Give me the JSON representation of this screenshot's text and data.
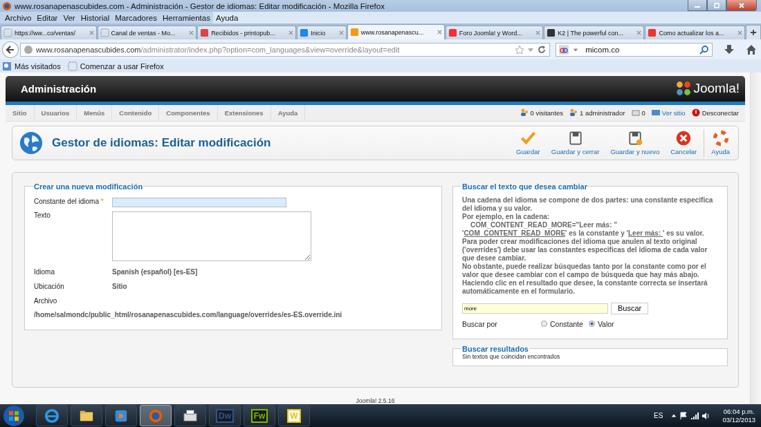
{
  "window": {
    "title": "www.rosanapenascubides.com - Administración - Gestor de idiomas: Editar modificación - Mozilla Firefox"
  },
  "menu_bar": [
    "Archivo",
    "Editar",
    "Ver",
    "Historial",
    "Marcadores",
    "Herramientas",
    "Ayuda"
  ],
  "tabs": [
    {
      "label": "https://ww...co/ventas/",
      "selected": false
    },
    {
      "label": "Canal de ventas - Mo...",
      "selected": false
    },
    {
      "label": "Recibidos - printopub...",
      "selected": false
    },
    {
      "label": "Inicio",
      "selected": false
    },
    {
      "label": "www.rosanapenascu...",
      "selected": true
    },
    {
      "label": "Foro Joomla! y Word...",
      "selected": false
    },
    {
      "label": "K2 | The powerful con...",
      "selected": false
    },
    {
      "label": "Como actualizar los a...",
      "selected": false
    }
  ],
  "address_bar": {
    "host": "www.rosanapenascubides.com",
    "path": "/administrator/index.php?option=com_languages&view=override&layout=edit"
  },
  "search_bar": {
    "value": "micom.co"
  },
  "bookmarks": [
    "Más visitados",
    "Comenzar a usar Firefox"
  ],
  "admin": {
    "title": "Administración",
    "logo": "Joomla!",
    "menu": [
      "Sitio",
      "Usuarios",
      "Menús",
      "Contenido",
      "Componentes",
      "Extensiones",
      "Ayuda"
    ],
    "status": [
      "0 visitantes",
      "1 administrador",
      "0",
      "Ver sitio",
      "Desconectar"
    ]
  },
  "page_title": "Gestor de idiomas: Editar modificación",
  "toolbar": [
    {
      "kind": "save",
      "label": "Guardar"
    },
    {
      "kind": "save-close",
      "label": "Guardar y cerrar"
    },
    {
      "kind": "save-new",
      "label": "Guardar y nuevo"
    },
    {
      "kind": "cancel",
      "label": "Cancelar"
    },
    {
      "kind": "help",
      "label": "Ayuda"
    }
  ],
  "create_form": {
    "legend": "Crear una nueva modificación",
    "constant_label": "Constante del idioma",
    "required_mark": "*",
    "text_label": "Texto",
    "language_label": "Idioma",
    "language": "Spanish (español) [es-ES]",
    "location_label": "Ubicación",
    "location": "Sitio",
    "file_label": "Archivo",
    "file": "/home/salmondc/public_html/rosanapenascubides.com/language/overrides/es-ES.override.ini"
  },
  "search_form": {
    "legend": "Buscar el texto que desea cambiar",
    "help": [
      [
        {
          "text": "Una cadena del idioma se compone de dos partes: una constante especifica del idioma y su valor.",
          "kind": "text"
        }
      ],
      [
        {
          "text": "Por ejemplo, en la cadena:",
          "kind": "text"
        }
      ],
      [
        {
          "text": "COM_CONTENT_READ_MORE=\"Leer más: \"",
          "kind": "text"
        }
      ],
      [
        {
          "text": "'",
          "kind": "text"
        },
        {
          "text": "COM_CONTENT_READ_MORE",
          "kind": "link"
        },
        {
          "text": "' es la constante y '",
          "kind": "text"
        },
        {
          "text": "Leer más: ",
          "kind": "link"
        },
        {
          "text": "' es su valor.",
          "kind": "text"
        }
      ],
      [
        {
          "text": "Para poder crear modificaciones del idioma que anulen al texto original ('overrides') debe usar las constantes especificas del idioma de cada valor que desee cambiar.",
          "kind": "text"
        }
      ],
      [
        {
          "text": "No obstante, puede realizar búsquedas tanto por la constante como por el valor que desee cambiar con el campo de búsqueda que hay más abajo.",
          "kind": "text"
        }
      ],
      [
        {
          "text": "Haciendo clic en el resultado que desee, la constante correcta se insertará automáticamente en el formulario.",
          "kind": "text"
        }
      ]
    ],
    "query": "more",
    "button": "Buscar",
    "search_by_label": "Buscar por",
    "search_by": [
      {
        "label": "Constante",
        "selected": false
      },
      {
        "label": "Valor",
        "selected": true
      }
    ]
  },
  "results": {
    "legend": "Buscar resultados",
    "message": "Sin textos que coincidan encontrados"
  },
  "footer": "Joomla! 2.5.16",
  "taskbar": {
    "apps": [
      {
        "kind": "ie",
        "selected": false
      },
      {
        "kind": "folder",
        "selected": false
      },
      {
        "kind": "media",
        "selected": false
      },
      {
        "kind": "firefox",
        "selected": true
      },
      {
        "kind": "scanner",
        "selected": false
      },
      {
        "kind": "letter",
        "label": "Dw",
        "selected": false
      },
      {
        "kind": "letter",
        "label": "Fw",
        "selected": false
      },
      {
        "kind": "letter",
        "label": "W",
        "selected": false
      }
    ],
    "language": "ES",
    "time": "06:04 p.m.",
    "date": "03/12/2013"
  }
}
